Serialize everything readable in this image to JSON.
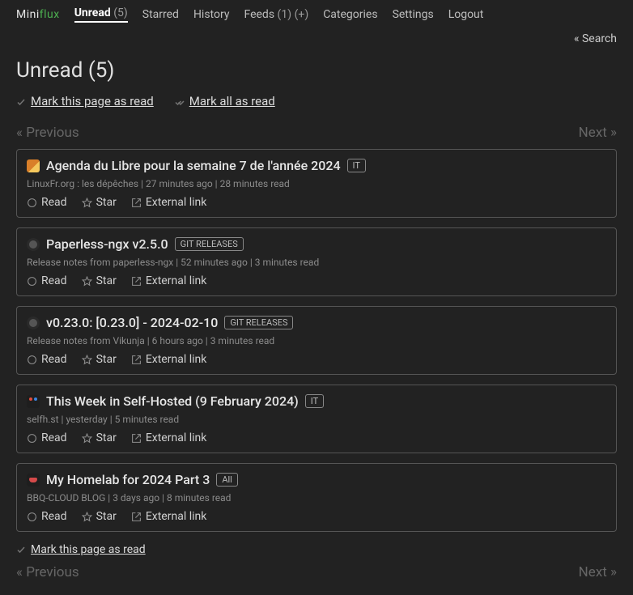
{
  "brand": {
    "mini": "Mini",
    "flux": "flux"
  },
  "nav": {
    "unread": {
      "label": "Unread",
      "count": "(5)"
    },
    "starred": "Starred",
    "history": "History",
    "feeds": {
      "label": "Feeds",
      "count": "(1)",
      "plus": "(+)"
    },
    "categories": "Categories",
    "settings": "Settings",
    "logout": "Logout"
  },
  "search": "« Search",
  "page_title": "Unread (5)",
  "mark_page": "Mark this page as read",
  "mark_all": "Mark all as read",
  "pager": {
    "prev": "« Previous",
    "next": "Next »"
  },
  "act": {
    "read": "Read",
    "star": "Star",
    "ext": "External link"
  },
  "entries": [
    {
      "fav": "fav-linuxfr",
      "title": "Agenda du Libre pour la semaine 7 de l'année 2024",
      "tag": "IT",
      "feed": "LinuxFr.org : les dépêches",
      "time": "27 minutes ago",
      "read": "28 minutes read"
    },
    {
      "fav": "fav-gh",
      "title": "Paperless-ngx v2.5.0",
      "tag": "GIT RELEASES",
      "feed": "Release notes from paperless-ngx",
      "time": "52 minutes ago",
      "read": "3 minutes read"
    },
    {
      "fav": "fav-gh",
      "title": "v0.23.0: [0.23.0] - 2024-02-10",
      "tag": "GIT RELEASES",
      "feed": "Release notes from Vikunja",
      "time": "6 hours ago",
      "read": "3 minutes read"
    },
    {
      "fav": "fav-selfh",
      "title": "This Week in Self-Hosted (9 February 2024)",
      "tag": "IT",
      "feed": "selfh.st",
      "time": "yesterday",
      "read": "5 minutes read"
    },
    {
      "fav": "fav-bbq",
      "title": "My Homelab for 2024 Part 3",
      "tag": "All",
      "feed": "BBQ-CLOUD BLOG",
      "time": "3 days ago",
      "read": "8 minutes read"
    }
  ]
}
